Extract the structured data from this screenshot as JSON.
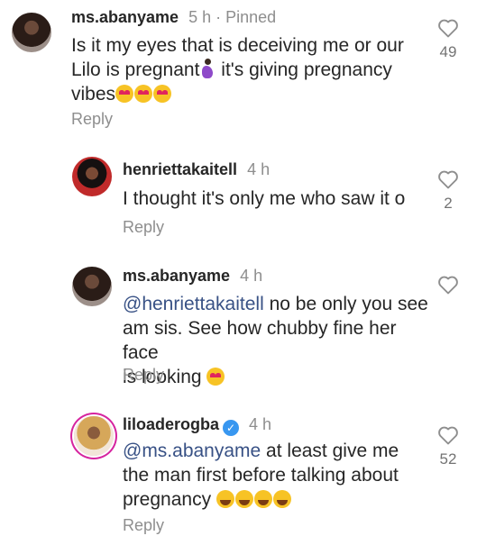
{
  "comments": [
    {
      "username": "ms.abanyame",
      "time": "5 h",
      "pinned": "· Pinned",
      "line1": "Is it my eyes that is deceiving me or our",
      "line2_prefix": "Lilo is pregnant",
      "line2_suffix": " it's giving pregnancy",
      "line3": "vibes",
      "emojis": [
        "smiling-face-with-heart-eyes",
        "smiling-face-with-heart-eyes",
        "smiling-face-with-heart-eyes"
      ],
      "inline_emoji": "pregnant-woman",
      "reply_label": "Reply",
      "like_count": "49"
    },
    {
      "username": "henriettakaitell",
      "time": "4 h",
      "line1": "I thought it's only me who saw it o",
      "reply_label": "Reply",
      "like_count": "2"
    },
    {
      "username": "ms.abanyame",
      "time": "4 h",
      "mention": "@henriettakaitell",
      "line1_rest": " no be only you see",
      "line2": "am sis. See how chubby fine her face",
      "line3": "is looking",
      "emojis": [
        "smiling-face-with-heart-eyes"
      ],
      "reply_label": "Reply",
      "like_count": ""
    },
    {
      "username": "liloaderogba",
      "verified": true,
      "time": "4 h",
      "mention": "@ms.abanyame",
      "line1_rest": " at least give me",
      "line2": "the man first before talking about",
      "line3": "pregnancy",
      "emojis": [
        "face-with-tears-of-joy",
        "face-with-tears-of-joy",
        "face-with-tears-of-joy",
        "face-with-tears-of-joy"
      ],
      "reply_label": "Reply",
      "like_count": "52"
    }
  ]
}
